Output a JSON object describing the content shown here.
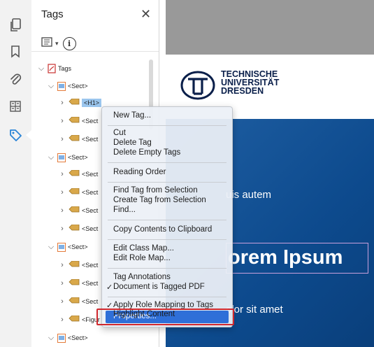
{
  "panel": {
    "title": "Tags",
    "close": "✕",
    "options_menu": "▾",
    "info": "i"
  },
  "tree": {
    "root": "Tags",
    "sect": "<Sect>",
    "h1": "<H1>",
    "sect_truncated": "<Sect",
    "figure_truncated": "<Figur"
  },
  "document": {
    "logo_line1": "TECHNISCHE",
    "logo_line2": "UNIVERSITÄT",
    "logo_line3": "DRESDEN",
    "text1": "uis autem",
    "heading": "orem Ipsum",
    "text2": "olor sit amet"
  },
  "menu": {
    "new_tag": "New Tag...",
    "cut": "Cut",
    "delete_tag": "Delete Tag",
    "delete_empty": "Delete Empty Tags",
    "reading_order": "Reading Order",
    "find_tag": "Find Tag from Selection",
    "create_tag": "Create Tag from Selection",
    "find": "Find...",
    "copy_contents": "Copy Contents to Clipboard",
    "edit_class_map": "Edit Class Map...",
    "edit_role_map": "Edit Role Map...",
    "tag_annotations": "Tag Annotations",
    "doc_tagged": "Document is Tagged PDF",
    "apply_role": "Apply Role Mapping to Tags",
    "highlight": "Highlight Content",
    "properties": "Properties...",
    "check": "✓"
  },
  "colors": {
    "selection": "#9bc6ee",
    "menu_highlight": "#2f6fd8",
    "callout": "#d0282e",
    "doc_blue": "#0d4a8d"
  }
}
